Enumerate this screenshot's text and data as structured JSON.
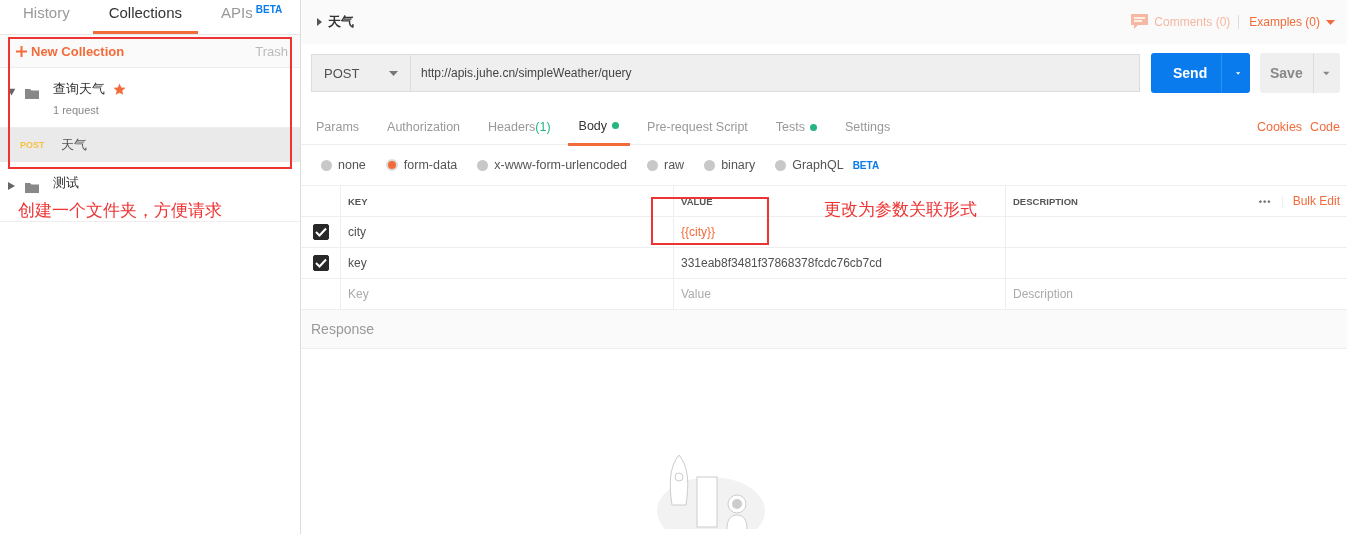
{
  "sidebar": {
    "tabs": [
      {
        "label": "History",
        "selected": false
      },
      {
        "label": "Collections",
        "selected": true
      },
      {
        "label": "APIs",
        "badge": "BETA",
        "selected": false
      }
    ],
    "new_collection": "New Collection",
    "trash": "Trash",
    "collections": [
      {
        "name": "查询天气",
        "subtitle": "1 request",
        "starred": true,
        "expanded": true,
        "requests": [
          {
            "method": "POST",
            "name": "天气",
            "selected": true
          }
        ]
      },
      {
        "name": "测试",
        "starred": false,
        "expanded": false
      }
    ]
  },
  "request": {
    "title": "天气",
    "comments": "Comments (0)",
    "examples": "Examples (0)",
    "method": "POST",
    "url": "http://apis.juhe.cn/simpleWeather/query",
    "send": "Send",
    "save": "Save",
    "tabs": [
      {
        "label": "Params",
        "dot": false,
        "selected": false
      },
      {
        "label": "Authorization",
        "dot": false,
        "selected": false
      },
      {
        "label": "Headers",
        "count": "(1)",
        "dot": false,
        "selected": false
      },
      {
        "label": "Body",
        "dot": true,
        "selected": true
      },
      {
        "label": "Pre-request Script",
        "dot": false,
        "selected": false
      },
      {
        "label": "Tests",
        "dot": true,
        "selected": false
      },
      {
        "label": "Settings",
        "dot": false,
        "selected": false
      }
    ],
    "links": [
      "Cookies",
      "Code"
    ],
    "body_types": [
      {
        "label": "none",
        "selected": false
      },
      {
        "label": "form-data",
        "selected": true
      },
      {
        "label": "x-www-form-urlencoded",
        "selected": false
      },
      {
        "label": "raw",
        "selected": false
      },
      {
        "label": "binary",
        "selected": false
      },
      {
        "label": "GraphQL",
        "badge": "BETA",
        "selected": false
      }
    ],
    "table": {
      "columns": [
        "KEY",
        "VALUE",
        "DESCRIPTION"
      ],
      "more": "•••",
      "bulk_edit": "Bulk Edit",
      "rows": [
        {
          "key": "city",
          "value": "{{city}}",
          "variable": true,
          "checked": true
        },
        {
          "key": "key",
          "value": "331eab8f3481f37868378fcdc76cb7cd",
          "variable": false,
          "checked": true
        }
      ],
      "new_row": [
        {
          "placeholder": "Key"
        },
        {
          "placeholder": "Value"
        },
        {
          "placeholder": "Description"
        }
      ]
    }
  },
  "response": {
    "title": "Response"
  },
  "annotations": [
    {
      "text": "创建一个文件夹，方便请求"
    },
    {
      "text": "更改为参数关联形式"
    }
  ]
}
